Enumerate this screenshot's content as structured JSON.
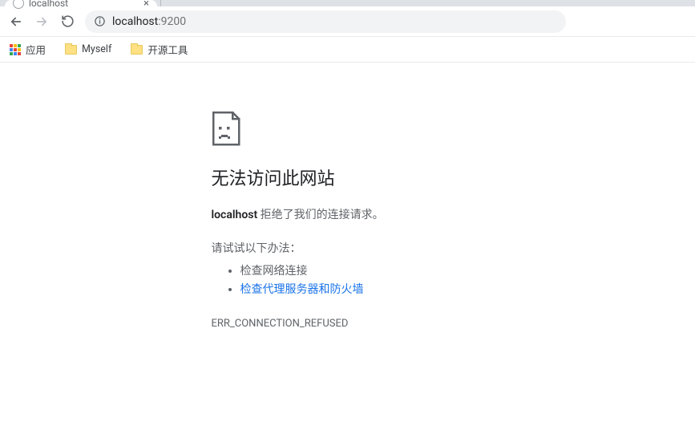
{
  "tab": {
    "title": "localhost",
    "close_glyph": "×"
  },
  "toolbar": {
    "url_host": "localhost",
    "url_port": ":9200"
  },
  "bookmarks": {
    "apps_label": "应用",
    "folder1": "Myself",
    "folder2": "开源工具"
  },
  "error": {
    "title": "无法访问此网站",
    "sub_bold": "localhost",
    "sub_rest": " 拒绝了我们的连接请求。",
    "try_title": "请试试以下办法：",
    "suggestion1": "检查网络连接",
    "suggestion2": "检查代理服务器和防火墙",
    "code": "ERR_CONNECTION_REFUSED"
  }
}
